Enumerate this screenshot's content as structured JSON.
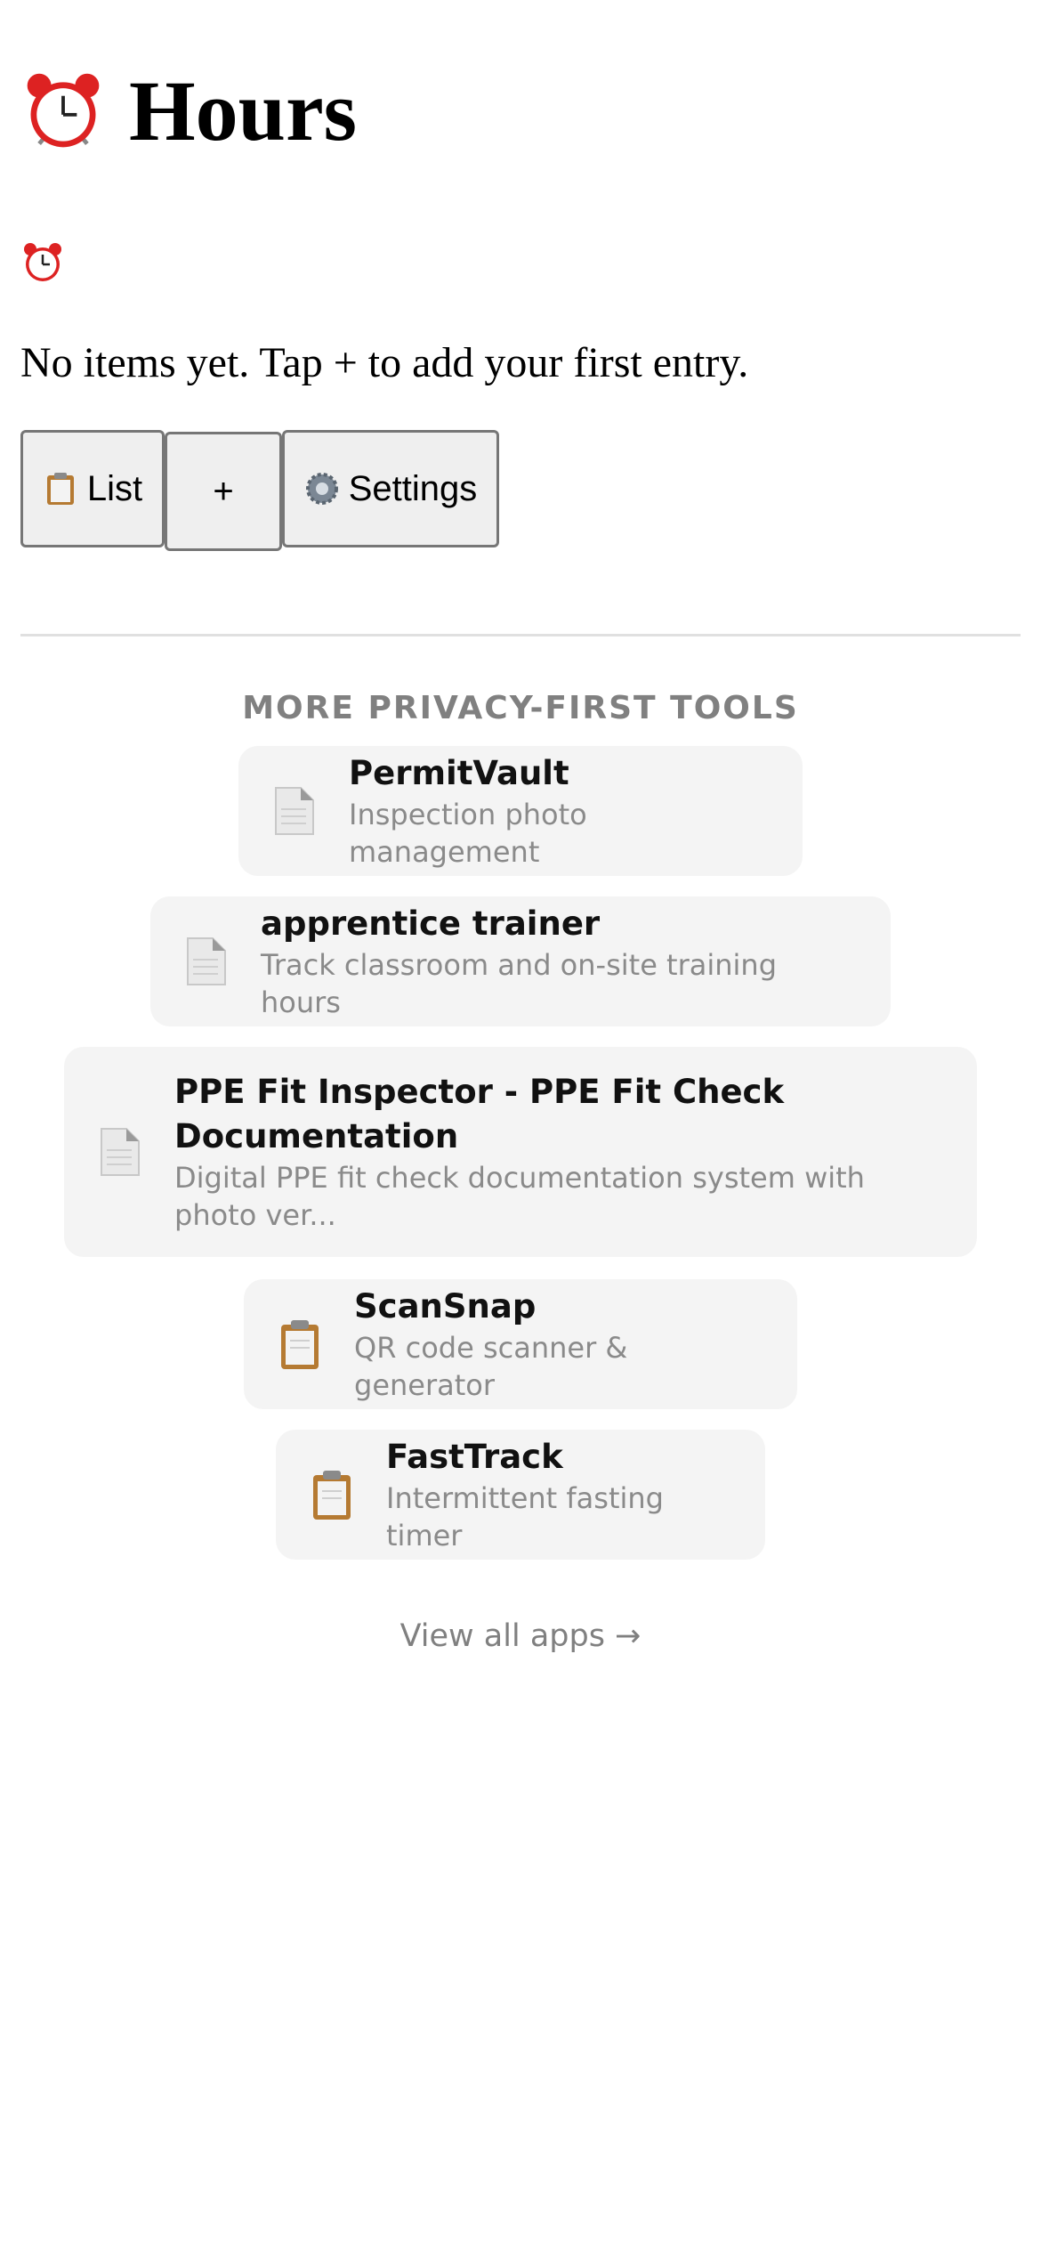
{
  "header": {
    "title": "Hours",
    "icon": "alarm-clock-icon"
  },
  "empty_state": {
    "icon": "alarm-clock-icon",
    "message": "No items yet. Tap + to add your first entry."
  },
  "toolbar": {
    "list_label": "List",
    "add_label": "+",
    "settings_label": "Settings"
  },
  "more_tools": {
    "heading": "MORE PRIVACY-FIRST TOOLS",
    "apps": [
      {
        "name": "PermitVault",
        "description": "Inspection photo management",
        "icon": "document-icon"
      },
      {
        "name": "apprentice trainer",
        "description": "Track classroom and on-site training hours",
        "icon": "document-icon"
      },
      {
        "name": "PPE Fit Inspector - PPE Fit Check Documentation",
        "description": "Digital PPE fit check documentation system with photo ver...",
        "icon": "document-icon"
      },
      {
        "name": "ScanSnap",
        "description": "QR code scanner & generator",
        "icon": "clipboard-icon"
      },
      {
        "name": "FastTrack",
        "description": "Intermittent fasting timer",
        "icon": "clipboard-icon"
      }
    ],
    "view_all": "View all apps →"
  }
}
